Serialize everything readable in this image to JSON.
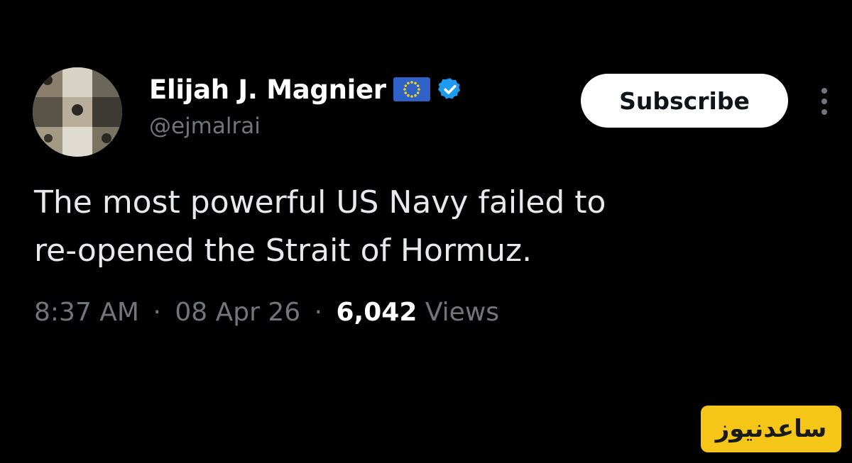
{
  "author": {
    "display_name": "Elijah J. Magnier",
    "handle": "@ejmalrai",
    "flag_icon": "eu-flag-icon",
    "verified_icon": "verified-badge-icon",
    "verified_color": "#1d9bf0"
  },
  "header": {
    "subscribe_label": "Subscribe",
    "more_icon": "more-vertical-icon"
  },
  "tweet": {
    "lines": [
      "The most powerful US Navy failed to",
      "re-opened the Strait of Hormuz."
    ]
  },
  "meta": {
    "time": "8:37 AM",
    "separator": "·",
    "date": "08 Apr 26",
    "views_count": "6,042",
    "views_label": "Views"
  },
  "watermark": {
    "text": "ساعدنیوز",
    "color": "#f5c518"
  }
}
